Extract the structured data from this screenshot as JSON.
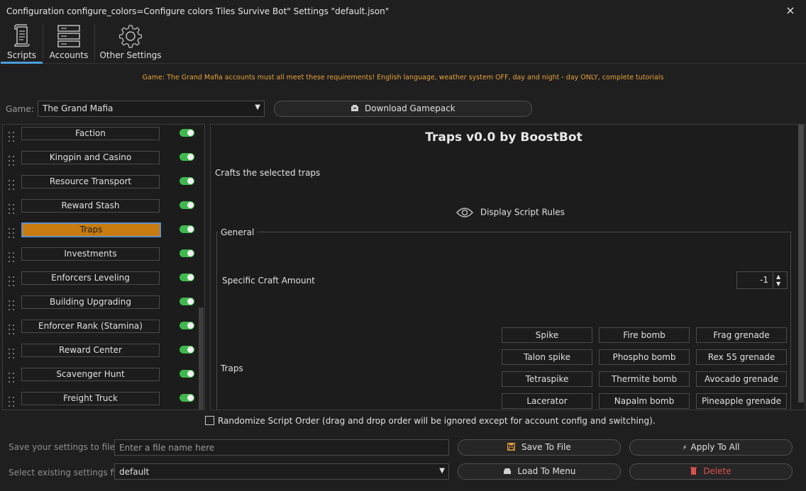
{
  "window": {
    "title": "Configuration configure_colors=Configure colors Tiles Survive Bot\" Settings \"default.json\"",
    "close_icon": "×"
  },
  "tabs": [
    {
      "label": "Scripts",
      "icon": "scroll-icon"
    },
    {
      "label": "Accounts",
      "icon": "server-stack-icon"
    },
    {
      "label": "Other Settings",
      "icon": "gear-icon"
    }
  ],
  "notice": "Game: The Grand Mafia accounts must all meet these requirements! English language, weather system OFF, day and night - day ONLY, complete tutorials",
  "game_row": {
    "label": "Game:",
    "selected": "The Grand Mafia",
    "download_label": "Download Gamepack"
  },
  "scripts": [
    {
      "label": "Faction",
      "enabled": true
    },
    {
      "label": "Kingpin and Casino",
      "enabled": true
    },
    {
      "label": "Resource Transport",
      "enabled": true
    },
    {
      "label": "Reward Stash",
      "enabled": true
    },
    {
      "label": "Traps",
      "enabled": true,
      "selected": true
    },
    {
      "label": "Investments",
      "enabled": true
    },
    {
      "label": "Enforcers Leveling",
      "enabled": true
    },
    {
      "label": "Building Upgrading",
      "enabled": true
    },
    {
      "label": "Enforcer Rank (Stamina)",
      "enabled": true
    },
    {
      "label": "Reward Center",
      "enabled": true
    },
    {
      "label": "Scavenger Hunt",
      "enabled": true
    },
    {
      "label": "Freight Truck",
      "enabled": true
    }
  ],
  "detail": {
    "title": "Traps v0.0 by BoostBot",
    "description": "Crafts the selected traps",
    "display_rules_label": "Display Script Rules",
    "group_label": "General",
    "craft_label": "Specific Craft Amount",
    "craft_value": "-1",
    "traps_label": "Traps",
    "trap_buttons": [
      [
        "Spike",
        "Fire bomb",
        "Frag grenade"
      ],
      [
        "Talon spike",
        "Phospho bomb",
        "Rex 55 grenade"
      ],
      [
        "Tetraspike",
        "Thermite bomb",
        "Avocado grenade"
      ],
      [
        "Lacerator",
        "Napalm bomb",
        "Pineapple grenade"
      ]
    ]
  },
  "randomize_label": "Randomize Script Order (drag and drop order will be ignored except for account config and switching).",
  "bottom": {
    "save_label": "Save your settings to file",
    "filename_placeholder": "Enter a file name here",
    "save_button": "Save To File",
    "apply_button": "Apply To All",
    "select_label": "Select existing settings file",
    "selected_file": "default",
    "load_button": "Load To Menu",
    "delete_button": "Delete"
  },
  "colors": {
    "accent_selected": "#c97c0f",
    "toggle_on": "#3fb84d",
    "notice": "#e8a33a",
    "delete": "#d9534f"
  }
}
